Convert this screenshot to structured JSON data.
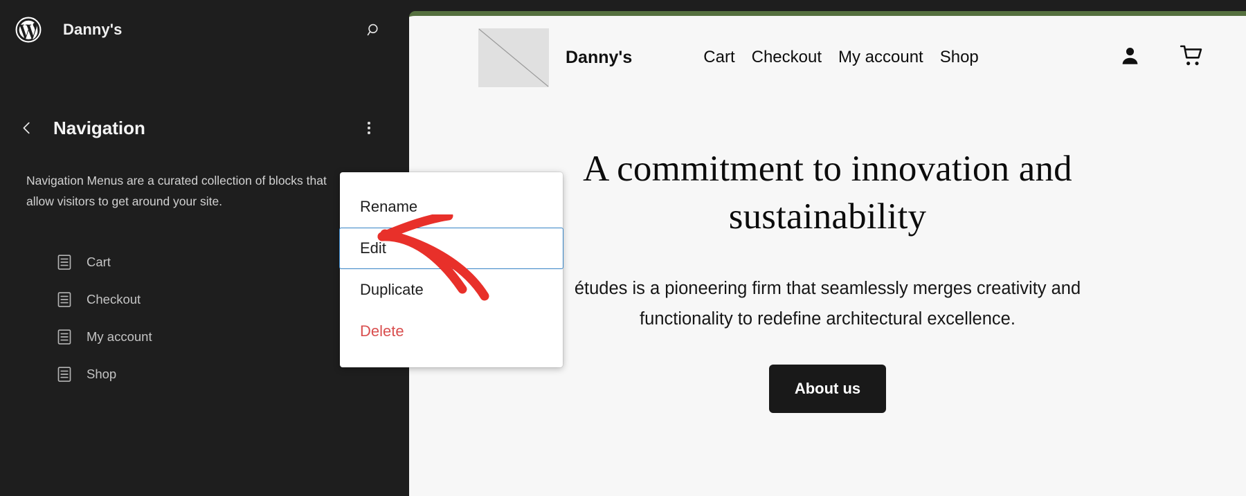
{
  "sidebar": {
    "logo_icon": "wordpress-logo-icon",
    "site_title": "Danny's",
    "search_icon": "search-icon",
    "back_icon": "chevron-left-icon",
    "panel_title": "Navigation",
    "kebab_icon": "more-options-icon",
    "description": "Navigation Menus are a curated collection of blocks that allow visitors to get around your site.",
    "nav_items": [
      {
        "label": "Cart",
        "icon": "document-icon"
      },
      {
        "label": "Checkout",
        "icon": "document-icon"
      },
      {
        "label": "My account",
        "icon": "document-icon"
      },
      {
        "label": "Shop",
        "icon": "document-icon"
      }
    ]
  },
  "dropdown": {
    "items": [
      {
        "label": "Rename",
        "state": "default"
      },
      {
        "label": "Edit",
        "state": "selected"
      },
      {
        "label": "Duplicate",
        "state": "default"
      },
      {
        "label": "Delete",
        "state": "danger"
      }
    ]
  },
  "annotation": {
    "type": "hand-drawn-arrow",
    "color": "#e8302a",
    "points_to": "Edit"
  },
  "preview": {
    "accent_bar_color": "#55703f",
    "header": {
      "logo_placeholder_icon": "image-placeholder-icon",
      "brand": "Danny's",
      "nav": [
        "Cart",
        "Checkout",
        "My account",
        "Shop"
      ],
      "account_icon": "user-account-icon",
      "cart_icon": "shopping-cart-icon"
    },
    "hero": {
      "heading": "A commitment to innovation and sustainability",
      "paragraph": "études is a pioneering firm that seamlessly merges creativity and functionality to redefine architectural excellence.",
      "button_label": "About us"
    }
  },
  "colors": {
    "sidebar_bg": "#1e1e1e",
    "canvas_bg": "#f7f7f7",
    "accent_green": "#55703f",
    "selected_border": "#3582c4",
    "danger": "#d94f4f",
    "annotation_red": "#e8302a"
  }
}
